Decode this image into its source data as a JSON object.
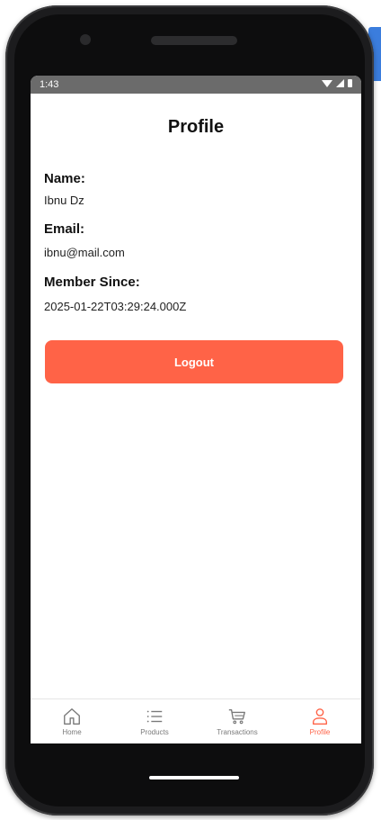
{
  "status_bar": {
    "time": "1:43"
  },
  "profile": {
    "title": "Profile",
    "fields": [
      {
        "label": "Name:",
        "value": "Ibnu Dz"
      },
      {
        "label": "Email:",
        "value": "ibnu@mail.com"
      },
      {
        "label": "Member Since:",
        "value": "2025-01-22T03:29:24.000Z"
      }
    ],
    "logout_label": "Logout"
  },
  "tabs": [
    {
      "label": "Home",
      "icon": "home-icon",
      "active": false
    },
    {
      "label": "Products",
      "icon": "list-icon",
      "active": false
    },
    {
      "label": "Transactions",
      "icon": "cart-icon",
      "active": false
    },
    {
      "label": "Profile",
      "icon": "person-icon",
      "active": true
    }
  ],
  "colors": {
    "accent": "#ff6347",
    "inactive_tab": "#7a7a7a",
    "status_bar": "#6b6b6b"
  }
}
